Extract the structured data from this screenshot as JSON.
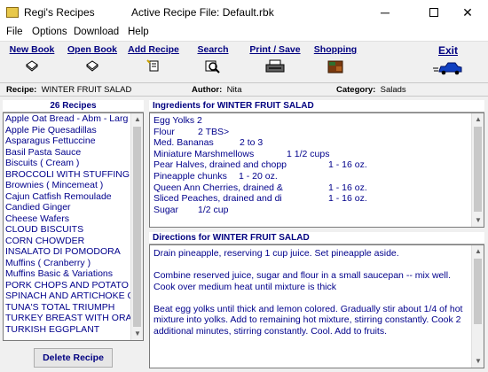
{
  "window": {
    "app_title": "Regi's Recipes",
    "active_file": "Active Recipe File:  Default.rbk",
    "min_glyph": "─",
    "close_glyph": "✕"
  },
  "menu": [
    "File",
    "Options",
    "Download",
    "Help"
  ],
  "toolbar": {
    "new_book": "New Book",
    "open_book": "Open Book",
    "add_recipe": "Add Recipe",
    "search": "Search",
    "print_save": "Print / Save",
    "shopping": "Shopping",
    "exit": "Exit"
  },
  "info": {
    "recipe_label": "Recipe:",
    "recipe_value": "WINTER FRUIT SALAD",
    "author_label": "Author:",
    "author_value": "Nita",
    "category_label": "Category:",
    "category_value": "Salads"
  },
  "recipes": {
    "header": "26 Recipes",
    "items": [
      "Apple Oat Bread - Abm - Larg",
      "Apple Pie Quesadillas",
      "Asparagus Fettuccine",
      "Basil Pasta Sauce",
      "Biscuits ( Cream )",
      "BROCCOLI WITH STUFFING",
      "Brownies ( Mincemeat )",
      "Cajun Catfish Remoulade",
      "Candied Ginger",
      "Cheese Wafers",
      "CLOUD BISCUITS",
      "CORN CHOWDER",
      "INSALATO DI POMODORA",
      "Muffins ( Cranberry )",
      "Muffins Basic & Variations",
      "PORK CHOPS AND POTATO",
      "SPINACH AND ARTICHOKE C",
      "TUNA'S TOTAL TRIUMPH",
      "TURKEY BREAST WITH ORA",
      "TURKISH EGGPLANT"
    ],
    "delete_label": "Delete Recipe"
  },
  "ingredients": {
    "header": "Ingredients for WINTER FRUIT SALAD",
    "rows": [
      {
        "name": "Egg Yolks 2",
        "amount": "",
        "unit": ""
      },
      {
        "name": "Flour",
        "amount": "2 TBS>",
        "unit": ""
      },
      {
        "name": "Med. Bananas",
        "amount": "2 to 3",
        "unit": ""
      },
      {
        "name": "Miniature Marshmellows",
        "amount": "1 1/2 cups",
        "unit": ""
      },
      {
        "name": "Pear Halves, drained and chopp",
        "amount": "",
        "unit": "1 - 16 oz."
      },
      {
        "name": "Pineapple chunks",
        "amount": "1 - 20 oz.",
        "unit": ""
      },
      {
        "name": "Queen Ann Cherries, drained &",
        "amount": "",
        "unit": "1 - 16 oz."
      },
      {
        "name": "Sliced Peaches, drained and di",
        "amount": "",
        "unit": "1 - 16 oz."
      },
      {
        "name": "Sugar",
        "amount": "1/2 cup",
        "unit": ""
      }
    ]
  },
  "directions": {
    "header": "Directions for WINTER FRUIT SALAD",
    "p1": "Drain pineapple, reserving 1 cup juice.  Set pineapple aside.",
    "p2": " Combine reserved juice, sugar and flour in a small saucepan -- mix well.  Cook over medium heat until mixture is thick",
    "p3": "Beat egg yolks until thick and lemon colored.   Gradually stir about 1/4 of hot mixture into yolks. Add to remaining hot mixture, stirring constantly.  Cook 2 additional minutes, stirring constantly.  Cool.  Add to fruits."
  }
}
